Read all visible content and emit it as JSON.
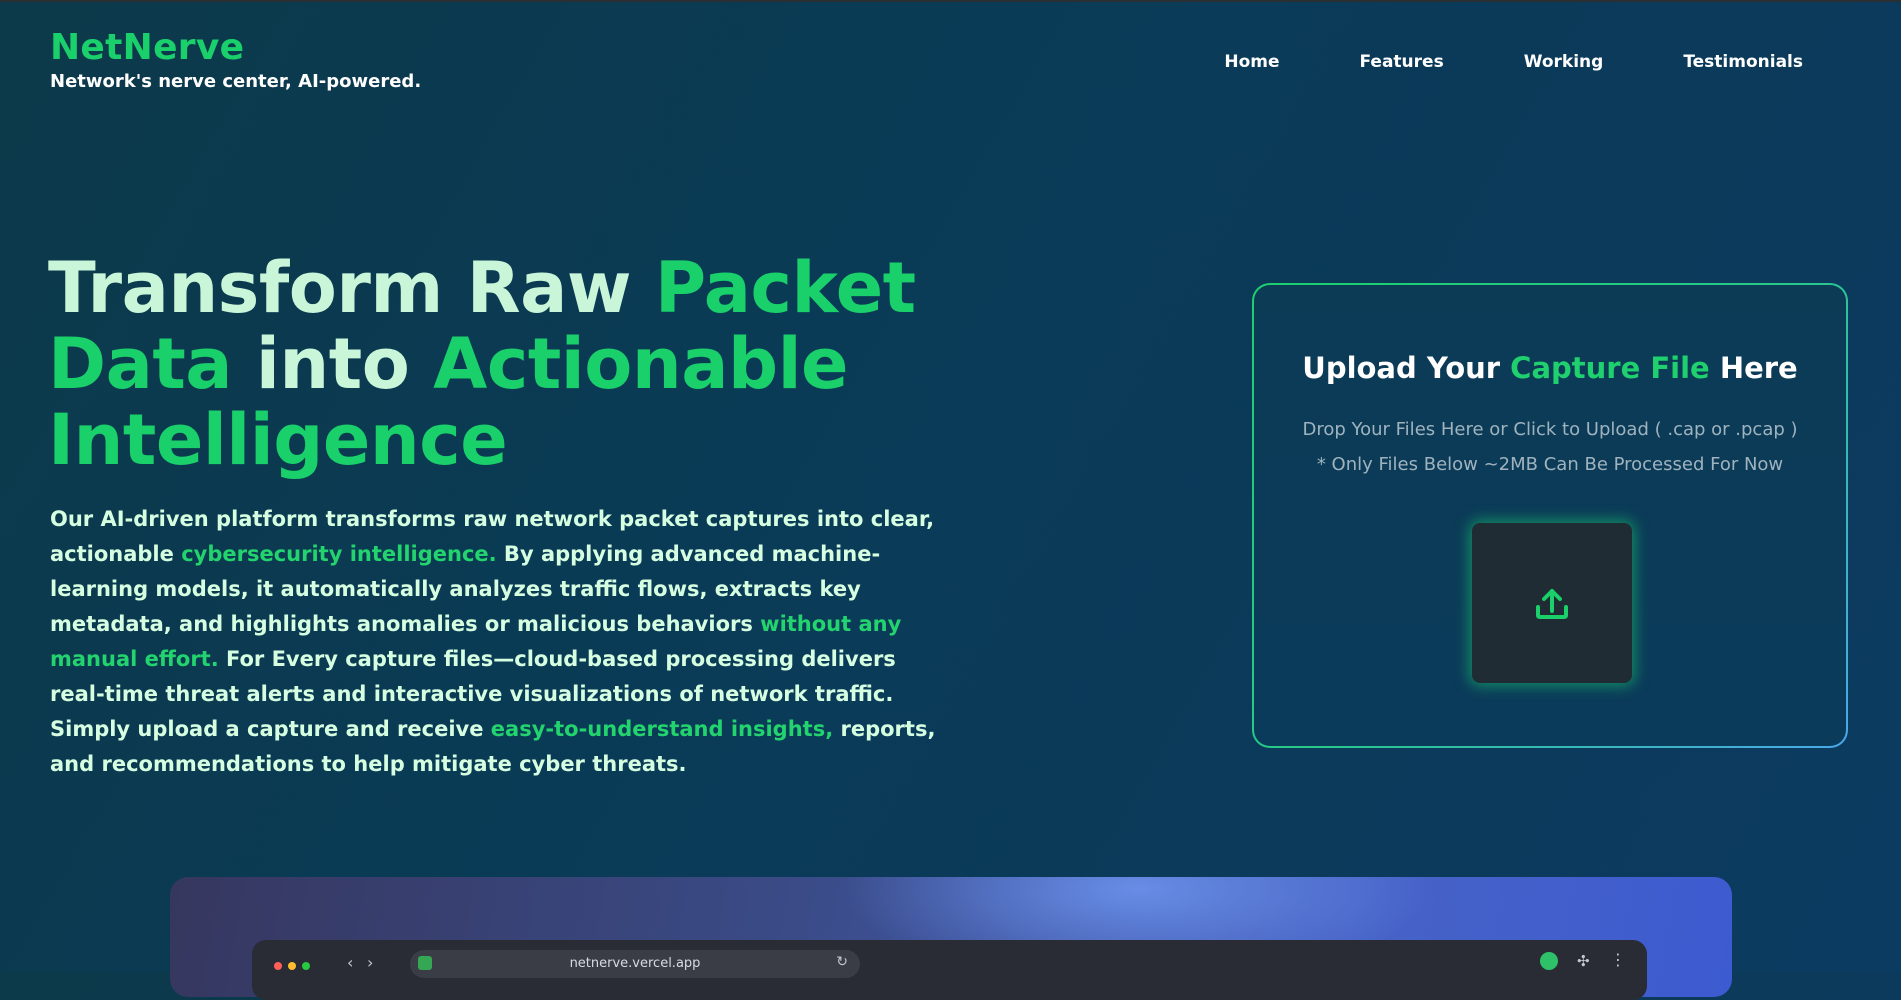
{
  "brand": {
    "name": "NetNerve",
    "tagline": "Network's nerve center, AI-powered."
  },
  "nav": {
    "home": "Home",
    "features": "Features",
    "working": "Working",
    "testimonials": "Testimonials"
  },
  "hero": {
    "title_part1": "Transform Raw ",
    "title_part2": "Packet Data",
    "title_part3": " into ",
    "title_part4": "Actionable Intelligence",
    "desc_part1": "Our AI-driven platform transforms raw network packet captures into clear, actionable ",
    "desc_hl1": "cybersecurity intelligence.",
    "desc_part2": " By applying advanced machine-learning models, it automatically analyzes traffic flows, extracts key metadata, and highlights anomalies or malicious behaviors ",
    "desc_hl2": "without any manual effort.",
    "desc_part3": " For Every capture files—cloud-based processing delivers real-time threat alerts and interactive visualizations of network traffic. Simply upload a capture and receive ",
    "desc_hl3": "easy-to-understand insights,",
    "desc_part4": " reports, and recommendations to help mitigate cyber threats."
  },
  "upload": {
    "title_part1": "Upload Your ",
    "title_highlight": "Capture File",
    "title_part2": " Here",
    "line1": "Drop Your Files Here or Click to Upload ( .cap or .pcap )",
    "line2": "* Only Files Below ~2MB Can Be Processed For Now",
    "icon": "upload-icon"
  },
  "preview": {
    "url": "netnerve.vercel.app"
  },
  "colors": {
    "accent": "#19d06b",
    "background": "#0b3a55",
    "title_light": "#c9f6d9"
  }
}
